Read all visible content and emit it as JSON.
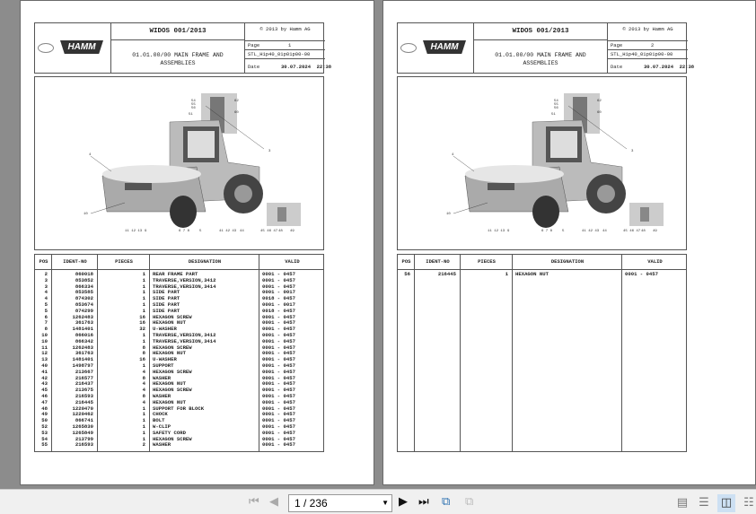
{
  "pages": [
    {
      "header": {
        "title": "WIDOS 001/2013",
        "copyright": "© 2013 by Hamm AG",
        "subtitle_line1": "01.01.00/00 MAIN FRAME AND",
        "subtitle_line2": "ASSEMBLIES",
        "page_label": "Page",
        "page_number": "1",
        "doc_id": "STL_H1p40_01p01p00-00",
        "date_label": "Date",
        "date": "30.07.2024  22:38",
        "brand": "HAMM",
        "group_logo": "WIRTGEN GROUP"
      },
      "callouts": [
        "54",
        "55",
        "56",
        "51",
        "62",
        "60",
        "3",
        "4",
        "10",
        "11 12 13",
        "9",
        "6 7 8",
        "5",
        "41 42 43",
        "44",
        "45 46 47",
        "48",
        "49"
      ],
      "table": {
        "headers": [
          "POS",
          "IDENT-NO",
          "PIECES",
          "DESIGNATION",
          "VALID"
        ],
        "rows": [
          [
            "2",
            "860018",
            "1",
            "REAR FRAME PART",
            "0001 - 0457"
          ],
          [
            "3",
            "853852",
            "1",
            "TRAVERSE,VERSION,3412",
            "0001 - 0457"
          ],
          [
            "3",
            "866334",
            "1",
            "TRAVERSE,VERSION,3414",
            "0001 - 0457"
          ],
          [
            "4",
            "853585",
            "1",
            "SIDE PART",
            "0001 - 0017"
          ],
          [
            "4",
            "874302",
            "1",
            "SIDE PART",
            "0018 - 0457"
          ],
          [
            "5",
            "853674",
            "1",
            "SIDE PART",
            "0001 - 0017"
          ],
          [
            "5",
            "874299",
            "1",
            "SIDE PART",
            "0018 - 0457"
          ],
          [
            "6",
            "1262483",
            "16",
            "HEXAGON SCREW",
            "0001 - 0457"
          ],
          [
            "7",
            "361763",
            "16",
            "HEXAGON NUT",
            "0001 - 0457"
          ],
          [
            "8",
            "1481401",
            "32",
            "U-WASHER",
            "0001 - 0457"
          ],
          [
            "10",
            "866016",
            "1",
            "TRAVERSE,VERSION,3412",
            "0001 - 0457"
          ],
          [
            "10",
            "866342",
            "1",
            "TRAVERSE,VERSION,3414",
            "0001 - 0457"
          ],
          [
            "11",
            "1262483",
            "8",
            "HEXAGON SCREW",
            "0001 - 0457"
          ],
          [
            "12",
            "361763",
            "8",
            "HEXAGON NUT",
            "0001 - 0457"
          ],
          [
            "13",
            "1481401",
            "16",
            "U-WASHER",
            "0001 - 0457"
          ],
          [
            "40",
            "1498797",
            "1",
            "SUPPORT",
            "0001 - 0457"
          ],
          [
            "41",
            "213667",
            "4",
            "HEXAGON SCREW",
            "0001 - 0457"
          ],
          [
            "42",
            "216577",
            "8",
            "WASHER",
            "0001 - 0457"
          ],
          [
            "43",
            "216437",
            "4",
            "HEXAGON NUT",
            "0001 - 0457"
          ],
          [
            "45",
            "213675",
            "4",
            "HEXAGON SCREW",
            "0001 - 0457"
          ],
          [
            "46",
            "216593",
            "8",
            "WASHER",
            "0001 - 0457"
          ],
          [
            "47",
            "216445",
            "4",
            "HEXAGON NUT",
            "0001 - 0457"
          ],
          [
            "48",
            "1220470",
            "1",
            "SUPPORT FOR BLOCK",
            "0001 - 0457"
          ],
          [
            "49",
            "1220462",
            "1",
            "CHOCK",
            "0001 - 0457"
          ],
          [
            "50",
            "866741",
            "1",
            "BOLT",
            "0001 - 0457"
          ],
          [
            "52",
            "1265830",
            "1",
            "W-CLIP",
            "0001 - 0457"
          ],
          [
            "53",
            "1265849",
            "1",
            "SAFETY CORD",
            "0001 - 0457"
          ],
          [
            "54",
            "213799",
            "1",
            "HEXAGON SCREW",
            "0001 - 0457"
          ],
          [
            "55",
            "216593",
            "2",
            "WASHER",
            "0001 - 0457"
          ]
        ]
      }
    },
    {
      "header": {
        "title": "WIDOS 001/2013",
        "copyright": "© 2013 by Hamm AG",
        "subtitle_line1": "01.01.00/00 MAIN FRAME AND",
        "subtitle_line2": "ASSEMBLIES",
        "page_label": "Page",
        "page_number": "2",
        "doc_id": "STL_H1p40_01p01p00-00",
        "date_label": "Date",
        "date": "30.07.2024  22:38",
        "brand": "HAMM",
        "group_logo": "WIRTGEN GROUP"
      },
      "callouts": [
        "54",
        "55",
        "56",
        "51",
        "62",
        "60",
        "3",
        "4",
        "10",
        "11 12 13",
        "9",
        "6 7 8",
        "5",
        "41 42 43",
        "44",
        "45 46 47",
        "48",
        "49"
      ],
      "table": {
        "headers": [
          "POS",
          "IDENT-NO",
          "PIECES",
          "DESIGNATION",
          "VALID"
        ],
        "rows": [
          [
            "56",
            "216445",
            "1",
            "HEXAGON NUT",
            "0001 - 0457"
          ]
        ]
      }
    }
  ],
  "toolbar": {
    "page_field": "1 / 236",
    "icons": [
      "first-page-icon",
      "prev-page-icon",
      "next-page-icon",
      "last-page-icon",
      "go-back-icon",
      "go-forward-icon",
      "single-page-view-icon",
      "continuous-view-icon",
      "two-page-view-icon",
      "two-page-continuous-view-icon"
    ]
  }
}
